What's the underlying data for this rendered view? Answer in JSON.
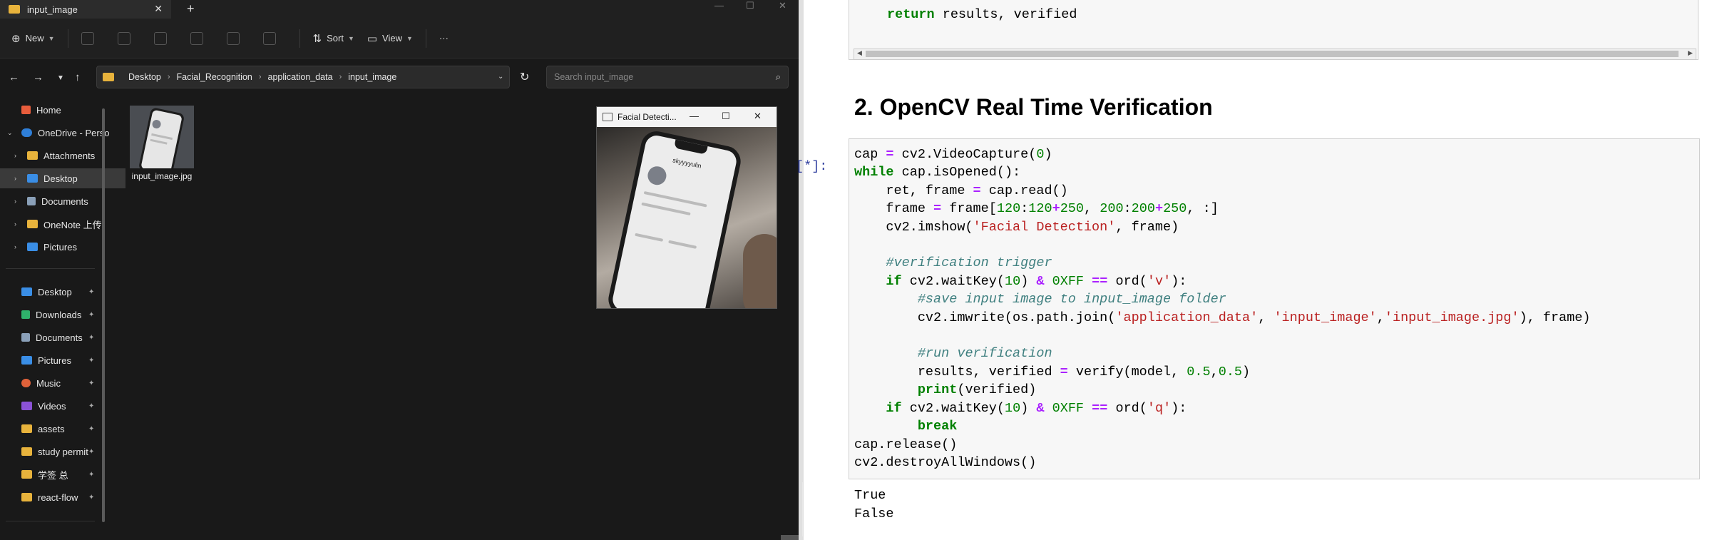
{
  "explorer": {
    "tab_title": "input_image",
    "toolbar": {
      "new": "New",
      "sort": "Sort",
      "view": "View",
      "more": "···"
    },
    "breadcrumb": [
      "Desktop",
      "Facial_Recognition",
      "application_data",
      "input_image"
    ],
    "search_placeholder": "Search input_image",
    "sidebar": {
      "home": "Home",
      "onedrive": "OneDrive - Perso",
      "attachments": "Attachments",
      "desktop": "Desktop",
      "documents": "Documents",
      "onenote": "OneNote 上传",
      "pictures": "Pictures",
      "quick": [
        "Desktop",
        "Downloads",
        "Documents",
        "Pictures",
        "Music",
        "Videos",
        "assets",
        "study permit",
        "学签 总",
        "react-flow"
      ]
    },
    "file": {
      "name": "input_image.jpg"
    }
  },
  "camera_window": {
    "title": "Facial Detecti...",
    "phone_user": "skyyyyulin"
  },
  "notebook": {
    "prev_code_line": "return results, verified",
    "heading": "2. OpenCV Real Time Verification",
    "prompt": "[*]:",
    "code_lines": [
      "cap = cv2.VideoCapture(0)",
      "while cap.isOpened():",
      "    ret, frame = cap.read()",
      "    frame = frame[120:120+250, 200:200+250, :]",
      "    cv2.imshow('Facial Detection', frame)",
      "",
      "    #verification trigger",
      "    if cv2.waitKey(10) & 0XFF == ord('v'):",
      "        #save input image to input_image folder",
      "        cv2.imwrite(os.path.join('application_data', 'input_image','input_image.jpg'), frame)",
      "",
      "        #run verification",
      "        results, verified = verify(model, 0.5,0.5)",
      "        print(verified)",
      "    if cv2.waitKey(10) & 0XFF == ord('q'):",
      "        break",
      "cap.release()",
      "cv2.destroyAllWindows()"
    ],
    "output_lines": [
      "True",
      "False"
    ]
  }
}
